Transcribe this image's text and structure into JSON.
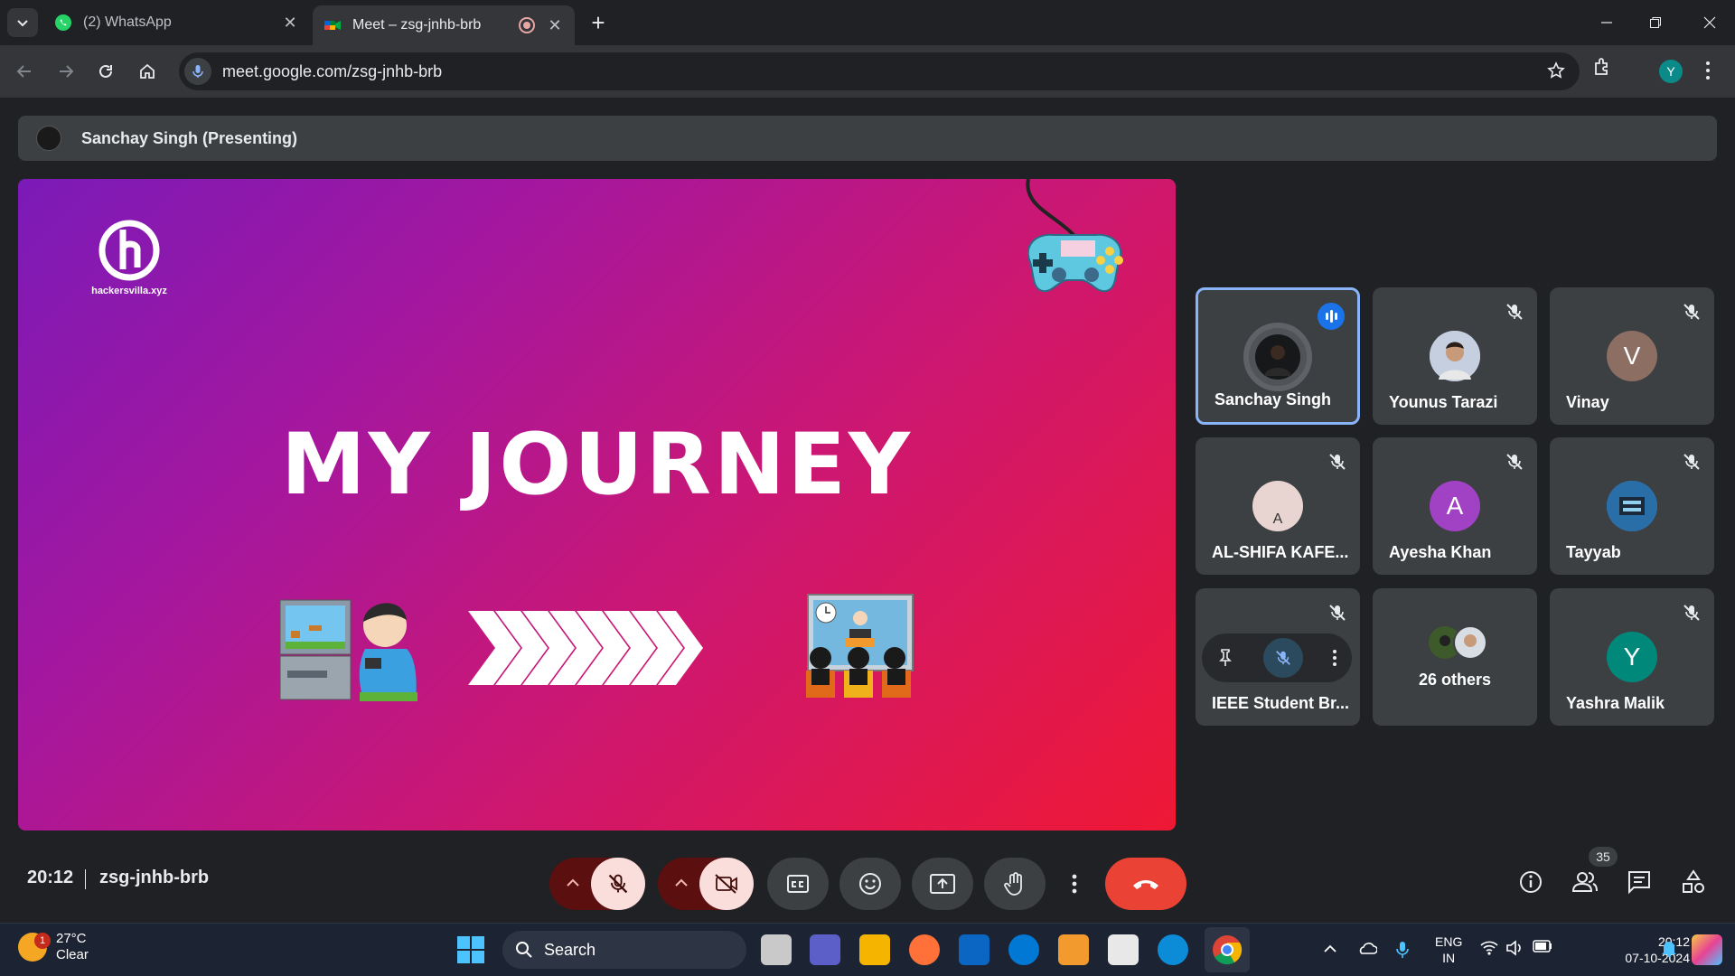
{
  "browser": {
    "tabs": [
      {
        "title": "(2) WhatsApp",
        "active": false
      },
      {
        "title": "Meet – zsg-jnhb-brb",
        "active": true
      }
    ],
    "url": "meet.google.com/zsg-jnhb-brb",
    "profile_initial": "Y"
  },
  "meet": {
    "presenting_banner": "Sanchay Singh (Presenting)",
    "slide": {
      "logo_text": "hackersvilla.xyz",
      "title": "MY JOURNEY"
    },
    "participants": [
      {
        "name": "Sanchay Singh",
        "speaking": true,
        "initial": "",
        "color": "#1a1a1a"
      },
      {
        "name": "Younus Tarazi",
        "speaking": false,
        "initial": "",
        "color": "#c5cfe0"
      },
      {
        "name": "Vinay",
        "speaking": false,
        "initial": "V",
        "color": "#8d6e63"
      },
      {
        "name": "AL-SHIFA KAFE...",
        "speaking": false,
        "initial": "A",
        "color": "#e8d4d0"
      },
      {
        "name": "Ayesha Khan",
        "speaking": false,
        "initial": "A",
        "color": "#a142c4"
      },
      {
        "name": "Tayyab",
        "speaking": false,
        "initial": "",
        "color": "#3a86c8"
      },
      {
        "name": "IEEE Student Br...",
        "speaking": false,
        "initial": "",
        "color": "#3c4043"
      },
      {
        "name": "26 others",
        "speaking": false,
        "initial": "",
        "color": "#3c4043"
      },
      {
        "name": "Yashra Malik",
        "speaking": false,
        "initial": "Y",
        "color": "#00897b"
      }
    ],
    "clock": "20:12",
    "meeting_code": "zsg-jnhb-brb",
    "people_count": "35"
  },
  "taskbar": {
    "temperature": "27°C",
    "weather": "Clear",
    "weather_badge": "1",
    "search_label": "Search",
    "lang_top": "ENG",
    "lang_bottom": "IN",
    "time": "20:12",
    "date": "07-10-2024"
  }
}
